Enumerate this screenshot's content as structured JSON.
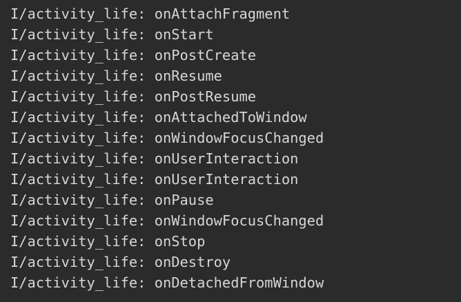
{
  "log": {
    "tag": "I/activity_life:",
    "lines": [
      {
        "tag": "I/activity_life:",
        "message": "onAttachFragment"
      },
      {
        "tag": "I/activity_life:",
        "message": "onStart"
      },
      {
        "tag": "I/activity_life:",
        "message": "onPostCreate"
      },
      {
        "tag": "I/activity_life:",
        "message": "onResume"
      },
      {
        "tag": "I/activity_life:",
        "message": "onPostResume"
      },
      {
        "tag": "I/activity_life:",
        "message": "onAttachedToWindow"
      },
      {
        "tag": "I/activity_life:",
        "message": "onWindowFocusChanged"
      },
      {
        "tag": "I/activity_life:",
        "message": "onUserInteraction"
      },
      {
        "tag": "I/activity_life:",
        "message": "onUserInteraction"
      },
      {
        "tag": "I/activity_life:",
        "message": "onPause"
      },
      {
        "tag": "I/activity_life:",
        "message": "onWindowFocusChanged"
      },
      {
        "tag": "I/activity_life:",
        "message": "onStop"
      },
      {
        "tag": "I/activity_life:",
        "message": "onDestroy"
      },
      {
        "tag": "I/activity_life:",
        "message": "onDetachedFromWindow"
      }
    ]
  },
  "colors": {
    "background": "#2b2b2b",
    "text": "#d6d6d6"
  }
}
